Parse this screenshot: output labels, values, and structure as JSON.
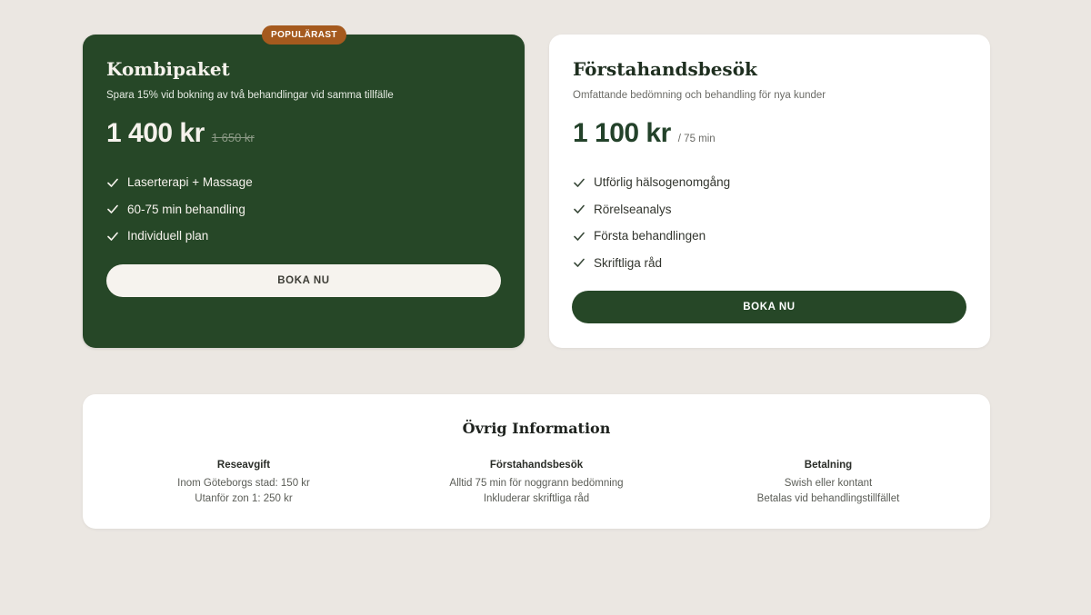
{
  "plans": {
    "featured": {
      "badge": "POPULÄRAST",
      "title": "Kombipaket",
      "subtitle": "Spara 15% vid bokning av två behandlingar vid samma tillfälle",
      "price": "1 400 kr",
      "old_price": "1 650 kr",
      "features": [
        "Laserterapi + Massage",
        "60-75 min behandling",
        "Individuell plan"
      ],
      "button": "BOKA NU"
    },
    "first_visit": {
      "title": "Förstahandsbesök",
      "subtitle": "Omfattande bedömning och behandling för nya kunder",
      "price": "1 100 kr",
      "unit": "/ 75 min",
      "features": [
        "Utförlig hälsogenomgång",
        "Rörelseanalys",
        "Första behandlingen",
        "Skriftliga råd"
      ],
      "button": "BOKA NU"
    }
  },
  "info": {
    "title": "Övrig Information",
    "columns": [
      {
        "heading": "Reseavgift",
        "lines": [
          "Inom Göteborgs stad: 150 kr",
          "Utanför zon 1: 250 kr"
        ]
      },
      {
        "heading": "Förstahandsbesök",
        "lines": [
          "Alltid 75 min för noggrann bedömning",
          "Inkluderar skriftliga råd"
        ]
      },
      {
        "heading": "Betalning",
        "lines": [
          "Swish eller kontant",
          "Betalas vid behandlingstillfället"
        ]
      }
    ]
  },
  "colors": {
    "background": "#ebe7e2",
    "brand_green": "#264727",
    "badge_orange": "#a55a1e",
    "card_white": "#ffffff"
  },
  "icons": {
    "feature_bullet": "check-icon"
  }
}
